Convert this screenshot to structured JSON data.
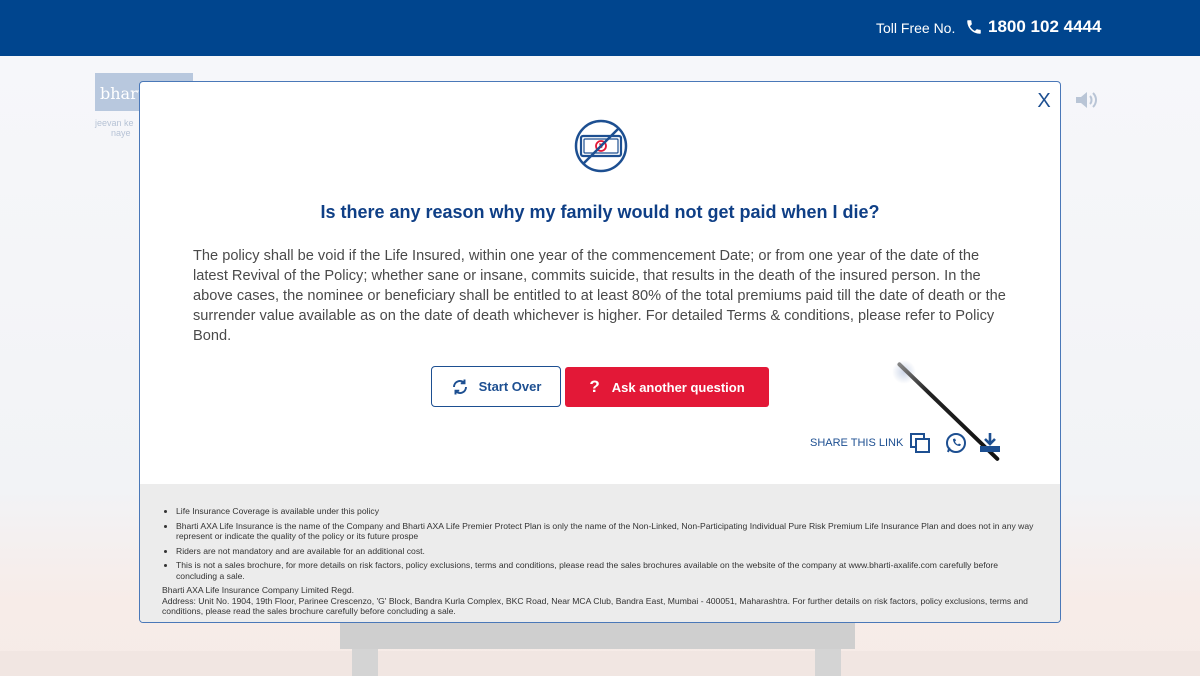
{
  "header": {
    "toll_free_label": "Toll Free No.",
    "toll_free_number": "1800 102 4444",
    "accent": "#00458e"
  },
  "background": {
    "logo_text": "bharti",
    "tagline_1": "jeevan ke",
    "tagline_2": "naye"
  },
  "modal": {
    "close_label": "X",
    "question": "Is there any reason why my family would not get paid when I die?",
    "answer": "The policy shall be void if the Life Insured, within one year of the commencement Date; or from one year of the date of the latest Revival of the Policy; whether sane or insane, commits suicide, that results in the death of the insured person. In the above cases, the nominee or beneficiary shall be entitled to at least 80% of the total premiums paid till the date of death or the surrender value available as on the date of death whichever is higher. For detailed Terms & conditions, please refer to Policy Bond.",
    "start_over_label": "Start Over",
    "ask_another_label": "Ask another question",
    "share_label": "SHARE THIS LINK",
    "ask_color": "#e31837"
  },
  "disclaimer": {
    "items": [
      "Life Insurance Coverage is available under this policy",
      "Bharti AXA Life Insurance is the name of the Company and Bharti AXA Life Premier Protect Plan is only the name of the Non-Linked, Non-Participating Individual Pure Risk Premium Life Insurance Plan and does not in any way represent or indicate the quality of the policy or its future prospe",
      "Riders are not mandatory and are available for an additional cost.",
      "This is not a sales brochure, for more details on risk factors, policy exclusions, terms and conditions, please read the sales brochures available on the website of the company at www.bharti-axalife.com carefully before concluding a sale."
    ],
    "company_line": "Bharti AXA Life Insurance Company Limited Regd.",
    "address_line": "Address: Unit No. 1904, 19th Floor, Parinee Crescenzo, 'G' Block, Bandra Kurla Complex, BKC Road, Near MCA Club, Bandra East, Mumbai - 400051, Maharashtra. For further details on risk factors, policy exclusions, terms and conditions, please read the sales brochure carefully before concluding a sale."
  }
}
